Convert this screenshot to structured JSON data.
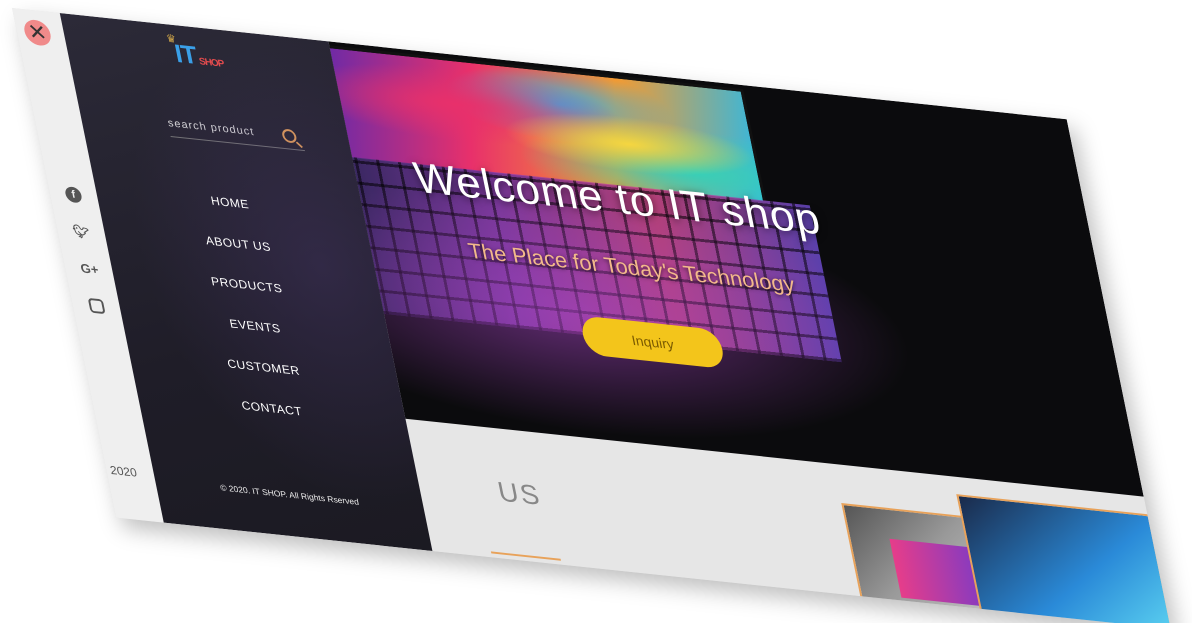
{
  "brand": {
    "logo_main": "IT",
    "logo_small": "SHOP"
  },
  "search": {
    "placeholder": "search product"
  },
  "nav": [
    {
      "label": "HOME"
    },
    {
      "label": "ABOUT US"
    },
    {
      "label": "PRODUCTS"
    },
    {
      "label": "EVENTS"
    },
    {
      "label": "CUSTOMER"
    },
    {
      "label": "CONTACT"
    }
  ],
  "socials": [
    "facebook-icon",
    "twitter-icon",
    "google-plus-icon",
    "instagram-icon"
  ],
  "footer": {
    "copyright": "© 2020. IT SHOP. All Rights Rserved",
    "year": "2020"
  },
  "hero": {
    "title": "Welcome to IT shop",
    "subtitle": "The Place for Today's Technology",
    "button": "Inquiry"
  },
  "about": {
    "title": "US"
  },
  "colors": {
    "accent": "#f3c51b",
    "sidebar": "#25232f",
    "subtitle": "#f2b98a",
    "close": "#f08a8a"
  }
}
